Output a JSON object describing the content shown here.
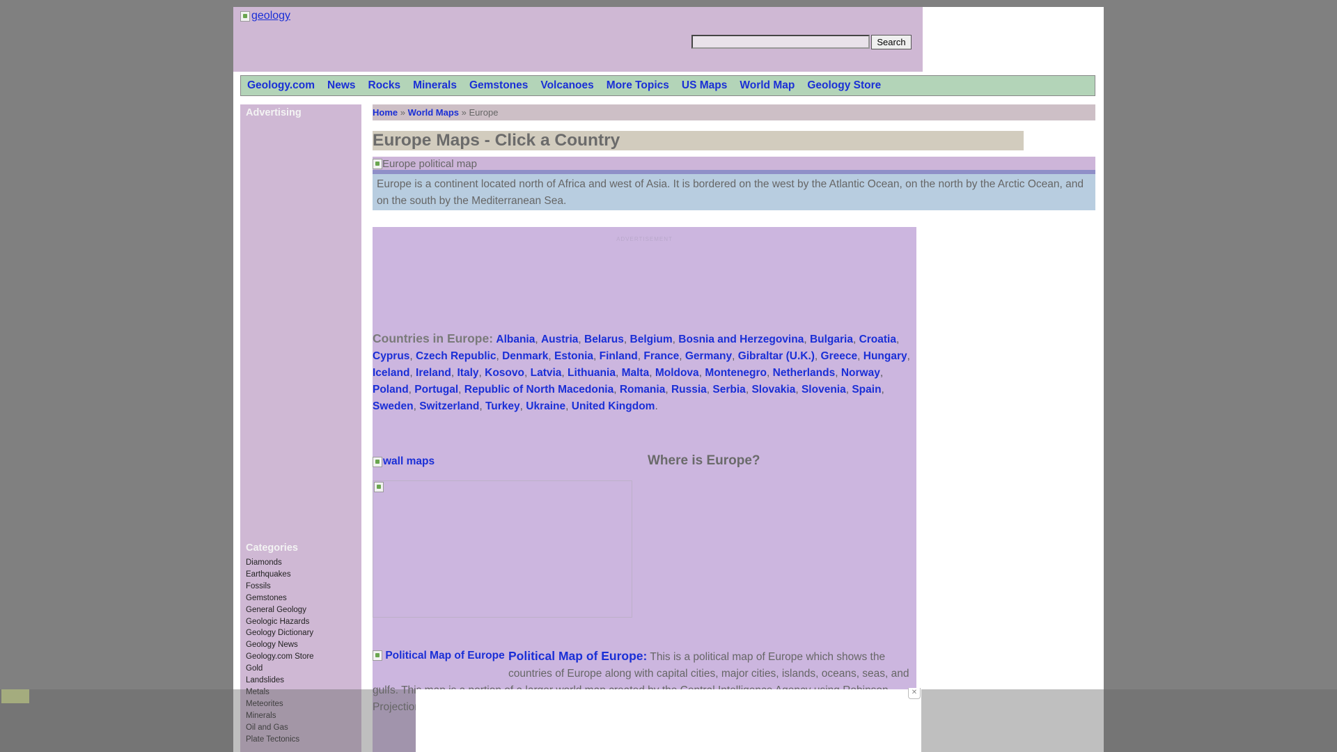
{
  "header": {
    "logo_alt": "geology",
    "search": {
      "value": "",
      "button_label": "Search"
    }
  },
  "nav": {
    "items": [
      "Geology.com",
      "News",
      "Rocks",
      "Minerals",
      "Gemstones",
      "Volcanoes",
      "More Topics",
      "US Maps",
      "World Map",
      "Geology Store"
    ]
  },
  "sidebar": {
    "advertising_heading": "Advertising",
    "categories_heading": "Categories",
    "categories": [
      "Diamonds",
      "Earthquakes",
      "Fossils",
      "Gemstones",
      "General Geology",
      "Geologic Hazards",
      "Geology Dictionary",
      "Geology News",
      "Geology.com Store",
      "Gold",
      "Landslides",
      "Metals",
      "Meteorites",
      "Minerals",
      "Oil and Gas",
      "Plate Tectonics"
    ]
  },
  "breadcrumb": {
    "home": "Home",
    "sep1": " » ",
    "world_maps": "World Maps",
    "sep2": " » ",
    "current": "Europe"
  },
  "main": {
    "title": "Europe Maps - Click a Country",
    "map_alt": "Europe political map",
    "intro": "Europe is a continent located north of Africa and west of Asia. It is bordered on the west by the Atlantic Ocean, on the north by the Arctic Ocean, and on the south by the Mediterranean Sea.",
    "ad_label": "ADVERTISEMENT",
    "countries_label": "Countries in Europe:",
    "countries": [
      "Albania",
      "Austria",
      "Belarus",
      "Belgium",
      "Bosnia and Herzegovina",
      "Bulgaria",
      "Croatia",
      "Cyprus",
      "Czech Republic",
      "Denmark",
      "Estonia",
      "Finland",
      "France",
      "Germany",
      "Gibraltar (U.K.)",
      "Greece",
      "Hungary",
      "Iceland",
      "Ireland",
      "Italy",
      "Kosovo",
      "Latvia",
      "Lithuania",
      "Malta",
      "Moldova",
      "Montenegro",
      "Netherlands",
      "Norway",
      "Poland",
      "Portugal",
      "Republic of North Macedonia",
      "Romania",
      "Russia",
      "Serbia",
      "Slovakia",
      "Slovenia",
      "Spain",
      "Sweden",
      "Switzerland",
      "Turkey",
      "Ukraine",
      "United Kingdom"
    ],
    "wall_maps_alt": "wall maps",
    "where_heading": "Where is Europe?",
    "political_map_alt": "Political Map of Europe",
    "political_title": "Political Map of Europe:",
    "political_text": " This is a political map of Europe which shows the countries of Europe along with capital cities, major cities, islands, oceans, seas, and gulfs. This map is a portion of a larger world map created by the Central Intelligence Agency using Robinson Projection. You can use the ... to view the map, pan-and-..."
  },
  "overlay": {
    "close_icon": "close-icon"
  }
}
